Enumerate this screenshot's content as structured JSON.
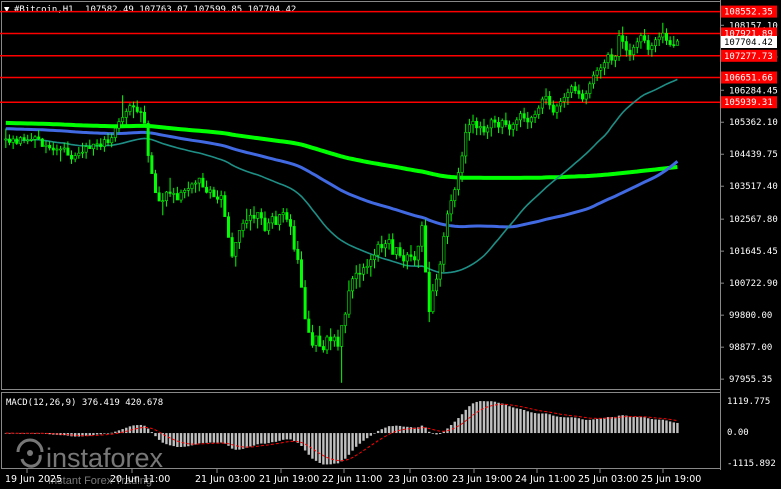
{
  "header": {
    "symbol_text": "#Bitcoin,H1",
    "ohlc_text": "107582.49 107763.07 107599.85 107704.42",
    "arrow_icon": "triangle-down-icon"
  },
  "price_axis": {
    "ticks": [
      "108157.10",
      "107234.29",
      "106284.45",
      "105362.10",
      "104439.75",
      "103517.40",
      "102567.80",
      "101645.45",
      "100722.90",
      "99800.00",
      "98877.00",
      "97955.35"
    ]
  },
  "horizontal_levels": [
    {
      "label": "108552.35",
      "color": "#ff0000"
    },
    {
      "label": "107921.89",
      "color": "#ff0000"
    },
    {
      "label": "107277.73",
      "color": "#ff0000"
    },
    {
      "label": "106651.66",
      "color": "#ff0000"
    },
    {
      "label": "105939.31",
      "color": "#ff0000"
    }
  ],
  "current_price": {
    "label": "107704.42"
  },
  "macd": {
    "label": "MACD(12,26,9) 376.419 420.678",
    "ticks": [
      "1119.775",
      "0.00",
      "-1115.892"
    ]
  },
  "time_axis": {
    "labels": [
      "19 Jun 2025",
      "20 Jun 11:00",
      "21 Jun 03:00",
      "21 Jun 19:00",
      "22 Jun 11:00",
      "23 Jun 03:00",
      "23 Jun 19:00",
      "24 Jun 11:00",
      "25 Jun 03:00",
      "25 Jun 19:00"
    ]
  },
  "watermark": {
    "brand": "instaforex",
    "tagline": "Instant Forex Trading"
  },
  "colors": {
    "candle": "#00ff00",
    "ma_fast": "#1e8f86",
    "ma_mid": "#4169e1",
    "ma_slow": "#00ff00",
    "level": "#ff0000",
    "macd_hist": "#c0c0c0",
    "macd_signal": "#ff0000"
  },
  "chart_data": {
    "type": "candlestick",
    "ylim": [
      97700,
      108800
    ],
    "candles": [
      [
        104870,
        105180,
        104620,
        104880
      ],
      [
        104880,
        105010,
        104700,
        104780
      ],
      [
        104780,
        104980,
        104590,
        104880
      ],
      [
        104880,
        104970,
        104710,
        104750
      ],
      [
        104750,
        104960,
        104680,
        104920
      ],
      [
        104920,
        105030,
        104760,
        104850
      ],
      [
        104850,
        105000,
        104730,
        104850
      ],
      [
        104850,
        105050,
        104800,
        104870
      ],
      [
        104870,
        104990,
        104620,
        104940
      ],
      [
        104940,
        105140,
        104850,
        104880
      ],
      [
        104880,
        104910,
        104730,
        104660
      ],
      [
        104660,
        104820,
        104470,
        104700
      ],
      [
        104700,
        104810,
        104550,
        104620
      ],
      [
        104620,
        104780,
        104410,
        104560
      ],
      [
        104560,
        104720,
        104410,
        104590
      ],
      [
        104590,
        104680,
        104230,
        104590
      ],
      [
        104590,
        104770,
        104490,
        104620
      ],
      [
        104620,
        104810,
        104520,
        104410
      ],
      [
        104410,
        104550,
        104160,
        104300
      ],
      [
        104300,
        104490,
        104210,
        104400
      ],
      [
        104400,
        104650,
        104310,
        104470
      ],
      [
        104470,
        104770,
        104330,
        104500
      ],
      [
        104500,
        104770,
        104310,
        104660
      ],
      [
        104660,
        104860,
        104610,
        104600
      ],
      [
        104600,
        104740,
        104400,
        104730
      ],
      [
        104730,
        104870,
        104560,
        104740
      ],
      [
        104740,
        104900,
        104560,
        104660
      ],
      [
        104660,
        104960,
        104510,
        104860
      ],
      [
        104860,
        105050,
        104680,
        104770
      ],
      [
        104770,
        105040,
        104640,
        104920
      ],
      [
        104920,
        105260,
        104800,
        105190
      ],
      [
        105190,
        105480,
        105070,
        105380
      ],
      [
        105380,
        106140,
        105240,
        105500
      ],
      [
        105500,
        105760,
        105290,
        105670
      ],
      [
        105670,
        105910,
        105560,
        105840
      ],
      [
        105840,
        105960,
        105480,
        105800
      ],
      [
        105800,
        105990,
        105620,
        105670
      ],
      [
        105670,
        105790,
        105360,
        105650
      ],
      [
        105650,
        105840,
        105460,
        105330
      ],
      [
        105330,
        105410,
        104200,
        104400
      ],
      [
        104400,
        104500,
        103900,
        103880
      ],
      [
        103880,
        103990,
        103450,
        103330
      ],
      [
        103330,
        103510,
        103140,
        103090
      ],
      [
        103090,
        103320,
        102680,
        103100
      ],
      [
        103100,
        103380,
        102930,
        103350
      ],
      [
        103350,
        103760,
        103210,
        103310
      ],
      [
        103310,
        103470,
        103030,
        103310
      ],
      [
        103310,
        103500,
        103120,
        103120
      ],
      [
        103120,
        103420,
        103040,
        103340
      ],
      [
        103340,
        103460,
        103170,
        103400
      ],
      [
        103400,
        103650,
        103220,
        103450
      ],
      [
        103450,
        103630,
        103310,
        103580
      ],
      [
        103580,
        103690,
        103330,
        103610
      ],
      [
        103610,
        103760,
        103370,
        103750
      ],
      [
        103750,
        103900,
        103490,
        103490
      ],
      [
        103490,
        103680,
        103310,
        103340
      ],
      [
        103340,
        103520,
        103160,
        103410
      ],
      [
        103410,
        103500,
        103250,
        103210
      ],
      [
        103210,
        103400,
        103020,
        103140
      ],
      [
        103140,
        103390,
        102900,
        103250
      ],
      [
        103250,
        103370,
        102760,
        102640
      ],
      [
        102640,
        102770,
        102150,
        102040
      ],
      [
        102040,
        102180,
        101450,
        101500
      ],
      [
        101500,
        101700,
        101200,
        101900
      ],
      [
        101900,
        102160,
        101710,
        102240
      ],
      [
        102240,
        102560,
        102040,
        102450
      ],
      [
        102450,
        102870,
        102300,
        102530
      ],
      [
        102530,
        102860,
        102240,
        102680
      ],
      [
        102680,
        102940,
        102450,
        102590
      ],
      [
        102590,
        102720,
        102300,
        102760
      ],
      [
        102760,
        102880,
        102400,
        102600
      ],
      [
        102600,
        102790,
        102200,
        102240
      ],
      [
        102240,
        102590,
        102120,
        102460
      ],
      [
        102460,
        102750,
        102290,
        102640
      ],
      [
        102640,
        102810,
        102470,
        102410
      ],
      [
        102410,
        102720,
        102240,
        102700
      ],
      [
        102700,
        102890,
        102470,
        102760
      ],
      [
        102760,
        102880,
        102480,
        102560
      ],
      [
        102560,
        102710,
        102110,
        102360
      ],
      [
        102360,
        102540,
        101630,
        101700
      ],
      [
        101700,
        101940,
        101280,
        101400
      ],
      [
        101400,
        101640,
        100690,
        100600
      ],
      [
        100600,
        100810,
        99750,
        99690
      ],
      [
        99690,
        99930,
        99430,
        99300
      ],
      [
        99300,
        99520,
        98860,
        98930
      ],
      [
        98930,
        99180,
        98740,
        99200
      ],
      [
        99200,
        99490,
        98940,
        98900
      ],
      [
        98900,
        99080,
        98720,
        98800
      ],
      [
        98800,
        99230,
        98680,
        99170
      ],
      [
        99170,
        99420,
        98790,
        99060
      ],
      [
        99060,
        99250,
        98890,
        99170
      ],
      [
        99170,
        99380,
        98780,
        98900
      ],
      [
        98900,
        99060,
        97850,
        99500
      ],
      [
        99500,
        99890,
        99280,
        99830
      ],
      [
        99830,
        100800,
        99720,
        100500
      ],
      [
        100500,
        100930,
        100280,
        100850
      ],
      [
        100850,
        101240,
        100560,
        101010
      ],
      [
        101010,
        101280,
        100600,
        100980
      ],
      [
        100980,
        101290,
        100790,
        101170
      ],
      [
        101170,
        101420,
        100990,
        101210
      ],
      [
        101210,
        101540,
        100910,
        101400
      ],
      [
        101400,
        101710,
        101150,
        101530
      ],
      [
        101530,
        101930,
        101340,
        101840
      ],
      [
        101840,
        102090,
        101610,
        101740
      ],
      [
        101740,
        101970,
        101480,
        101860
      ],
      [
        101860,
        102150,
        101690,
        101980
      ],
      [
        101980,
        102160,
        101720,
        101550
      ],
      [
        101550,
        101760,
        101410,
        101750
      ],
      [
        101750,
        101900,
        101460,
        101520
      ],
      [
        101520,
        101700,
        101170,
        101360
      ],
      [
        101360,
        101620,
        101120,
        101540
      ],
      [
        101540,
        101820,
        101350,
        101490
      ],
      [
        101490,
        101650,
        101220,
        101390
      ],
      [
        101390,
        101800,
        101160,
        101790
      ],
      [
        101790,
        102500,
        101620,
        102380
      ],
      [
        102380,
        102560,
        101260,
        101040
      ],
      [
        101040,
        101340,
        99600,
        99900
      ],
      [
        99900,
        100700,
        99840,
        100500
      ],
      [
        100500,
        100990,
        100350,
        100840
      ],
      [
        100840,
        101360,
        100620,
        101270
      ],
      [
        101270,
        102190,
        101040,
        102070
      ],
      [
        102070,
        102820,
        101850,
        102720
      ],
      [
        102720,
        103280,
        102500,
        103100
      ],
      [
        103100,
        103490,
        102910,
        103420
      ],
      [
        103420,
        104050,
        103250,
        103910
      ],
      [
        103910,
        104510,
        103640,
        104390
      ],
      [
        104390,
        105320,
        104170,
        105070
      ],
      [
        105070,
        105460,
        104830,
        105290
      ],
      [
        105290,
        105580,
        105040,
        105390
      ],
      [
        105390,
        105500,
        104990,
        105200
      ],
      [
        105200,
        105380,
        104990,
        105240
      ],
      [
        105240,
        105460,
        104980,
        105080
      ],
      [
        105080,
        105290,
        104880,
        105200
      ],
      [
        105200,
        105490,
        104950,
        105430
      ],
      [
        105430,
        105550,
        105200,
        105360
      ],
      [
        105360,
        105510,
        105050,
        105220
      ],
      [
        105220,
        105470,
        105020,
        105410
      ],
      [
        105410,
        105640,
        105220,
        105290
      ],
      [
        105290,
        105410,
        104980,
        105160
      ],
      [
        105160,
        105360,
        104950,
        105300
      ],
      [
        105300,
        105510,
        105110,
        105430
      ],
      [
        105430,
        105690,
        105220,
        105610
      ],
      [
        105610,
        105780,
        105370,
        105480
      ],
      [
        105480,
        105660,
        105170,
        105370
      ],
      [
        105370,
        105550,
        105190,
        105500
      ],
      [
        105500,
        105700,
        105340,
        105590
      ],
      [
        105590,
        105850,
        105460,
        105770
      ],
      [
        105770,
        106100,
        105600,
        106030
      ],
      [
        106030,
        106340,
        105870,
        106110
      ],
      [
        106110,
        106260,
        105730,
        105860
      ],
      [
        105860,
        105990,
        105560,
        105650
      ],
      [
        105650,
        105900,
        105460,
        105830
      ],
      [
        105830,
        106060,
        105650,
        105960
      ],
      [
        105960,
        106200,
        105780,
        106080
      ],
      [
        106080,
        106330,
        105860,
        106220
      ],
      [
        106220,
        106450,
        106060,
        106390
      ],
      [
        106390,
        106530,
        106180,
        106270
      ],
      [
        106270,
        106450,
        106040,
        106180
      ],
      [
        106180,
        106300,
        105950,
        106030
      ],
      [
        106030,
        106280,
        105880,
        106190
      ],
      [
        106190,
        106540,
        106050,
        106470
      ],
      [
        106470,
        106830,
        106330,
        106720
      ],
      [
        106720,
        106950,
        106550,
        106860
      ],
      [
        106860,
        107040,
        106620,
        106930
      ],
      [
        106930,
        107170,
        106720,
        107080
      ],
      [
        107080,
        107380,
        106900,
        107310
      ],
      [
        107310,
        107490,
        107020,
        107150
      ],
      [
        107150,
        107300,
        106950,
        107260
      ],
      [
        107260,
        108020,
        107130,
        107860
      ],
      [
        107860,
        108120,
        107480,
        107690
      ],
      [
        107690,
        107850,
        107250,
        107440
      ],
      [
        107440,
        107630,
        107130,
        107310
      ],
      [
        107310,
        107600,
        107150,
        107520
      ],
      [
        107520,
        107800,
        107350,
        107680
      ],
      [
        107680,
        107940,
        107480,
        107860
      ],
      [
        107860,
        108050,
        107640,
        107720
      ],
      [
        107720,
        107880,
        107300,
        107460
      ],
      [
        107460,
        107660,
        107250,
        107570
      ],
      [
        107570,
        107820,
        107380,
        107740
      ],
      [
        107740,
        107950,
        107560,
        107820
      ],
      [
        107820,
        108230,
        107640,
        107930
      ],
      [
        107930,
        108070,
        107590,
        107720
      ],
      [
        107720,
        107840,
        107540,
        107600
      ],
      [
        107600,
        107850,
        107510,
        107580
      ],
      [
        107580,
        107763,
        107600,
        107704
      ]
    ]
  }
}
